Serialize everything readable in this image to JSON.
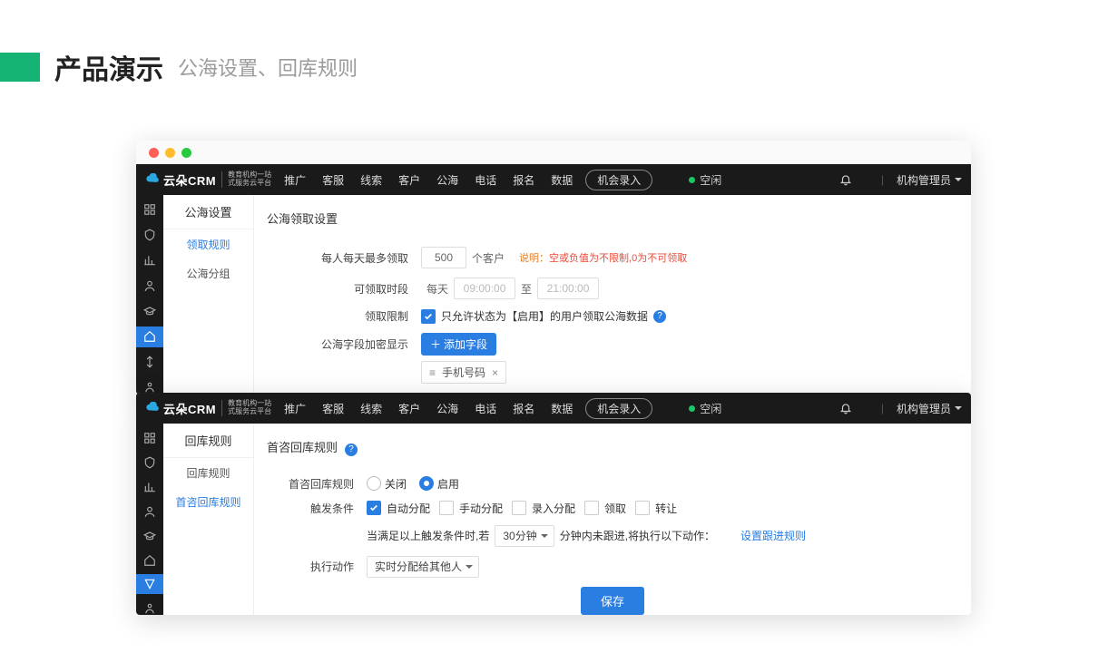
{
  "slide": {
    "title": "产品演示",
    "subtitle": "公海设置、回库规则"
  },
  "logo": {
    "text": "云朵CRM",
    "sub1": "教育机构一站",
    "sub2": "式服务云平台"
  },
  "nav": {
    "items": [
      "推广",
      "客服",
      "线索",
      "客户",
      "公海",
      "电话",
      "报名",
      "数据"
    ],
    "pill": "机会录入",
    "status": "空闲",
    "user": "机构管理员"
  },
  "win1": {
    "group": "公海设置",
    "menu": [
      "领取规则",
      "公海分组"
    ],
    "section": "公海领取设置",
    "row1": {
      "label": "每人每天最多领取",
      "value": "500",
      "unit": "个客户",
      "hint_prefix": "说明：",
      "hint": "空或负值为不限制,0为不可领取"
    },
    "row2": {
      "label": "可领取时段",
      "daily": "每天",
      "from": "09:00:00",
      "to_label": "至",
      "to": "21:00:00"
    },
    "row3": {
      "label": "领取限制",
      "text": "只允许状态为【启用】的用户领取公海数据"
    },
    "row4": {
      "label": "公海字段加密显示",
      "btn": "添加字段",
      "chip": "手机号码"
    }
  },
  "win2": {
    "group": "回库规则",
    "menu": [
      "回库规则",
      "首咨回库规则"
    ],
    "section": "首咨回库规则",
    "row1": {
      "label": "首咨回库规则",
      "off": "关闭",
      "on": "启用"
    },
    "row2": {
      "label": "触发条件",
      "opts": [
        "自动分配",
        "手动分配",
        "录入分配",
        "领取",
        "转让"
      ]
    },
    "row3": {
      "prefix": "当满足以上触发条件时,若",
      "sel": "30分钟",
      "suffix": "分钟内未跟进,将执行以下动作：",
      "link": "设置跟进规则"
    },
    "row4": {
      "label": "执行动作",
      "sel": "实时分配给其他人"
    },
    "save": "保存"
  }
}
